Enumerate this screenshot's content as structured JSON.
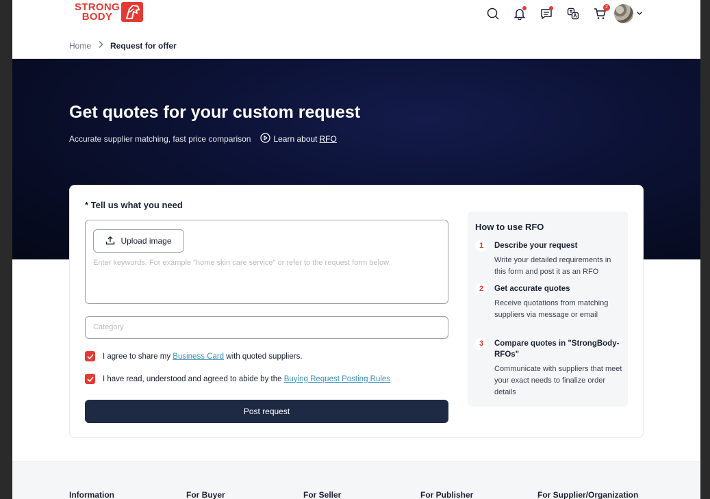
{
  "header": {
    "logo_line1": "STRONG",
    "logo_line2": "BODY",
    "cart_badge": "2"
  },
  "breadcrumb": {
    "home": "Home",
    "current": "Request for offer"
  },
  "hero": {
    "title": "Get quotes for your custom request",
    "subtitle": "Accurate supplier matching, fast price comparison",
    "learn_prefix": "Learn about",
    "learn_link": "RFO"
  },
  "form": {
    "title": "* Tell us what you need",
    "upload_label": "Upload image",
    "keywords_placeholder": "Enter keywords. For example \"home skin care service\" or refer to the request form below",
    "category_placeholder": "Category",
    "agree_share_prefix": "I agree to share my",
    "agree_share_link": "Business Card",
    "agree_share_suffix": "with quoted suppliers.",
    "agree_rules_prefix": "I have read, understood and agreed to abide by the",
    "agree_rules_link": "Buying Request Posting Rules",
    "agree_share_checked": true,
    "agree_rules_checked": true,
    "submit_label": "Post request"
  },
  "howto": {
    "title": "How to use RFO",
    "steps": [
      {
        "num": "1",
        "title": "Describe your request",
        "desc": "Write your detailed requirements in this form and post it as an RFO"
      },
      {
        "num": "2",
        "title": "Get accurate quotes",
        "desc": "Receive quotations from matching suppliers via message or email"
      },
      {
        "num": "3",
        "title": "Compare quotes in \"StrongBody- RFOs\"",
        "desc": "Communicate with suppliers that meet your exact needs to finalize order details"
      }
    ]
  },
  "footer": {
    "columns": [
      "Information",
      "For Buyer",
      "For Seller",
      "For Publisher",
      "For Supplier/Organization"
    ]
  },
  "colors": {
    "accent": "#e53935",
    "primary_button": "#1e2a44",
    "hero_bg": "#0c1235",
    "link": "#3b8fb8"
  }
}
